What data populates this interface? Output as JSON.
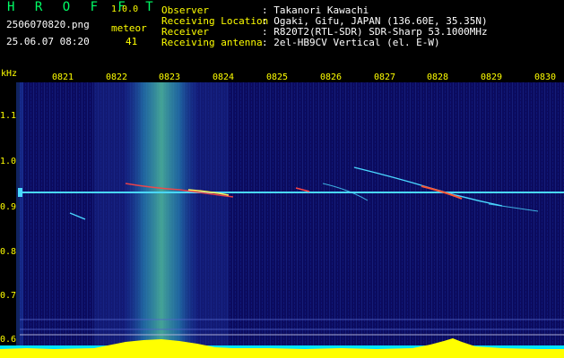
{
  "app": {
    "title": "H R O F F T",
    "version": "1.0.0"
  },
  "file": {
    "name": "2506070820.png",
    "datetime": "25.06.07 08:20"
  },
  "meteor": {
    "label": "meteor",
    "count": "41"
  },
  "info": [
    {
      "label": "Observer",
      "value": ": Takanori Kawachi"
    },
    {
      "label": "Receiving Location",
      "value": ": Ogaki, Gifu, JAPAN (136.60E, 35.35N)"
    },
    {
      "label": "Receiver",
      "value": ": R820T2(RTL-SDR) SDR-Sharp 53.1000MHz"
    },
    {
      "label": "Receiving antenna",
      "value": ": 2el-HB9CV Vertical (el. E-W)"
    }
  ],
  "axis": {
    "unit": "kHz",
    "y_ticks": [
      "1.1",
      "1.0",
      "0.9",
      "0.8",
      "0.7",
      "0.6"
    ],
    "x_ticks": [
      "0821",
      "0822",
      "0823",
      "0824",
      "0825",
      "0826",
      "0827",
      "0828",
      "0829",
      "0830"
    ]
  },
  "colors": {
    "title": "#00ff66",
    "labels": "#ffff00",
    "text": "#ffffff",
    "background": "#0a0a55",
    "carrier": "#4ad8ff",
    "level": "#ffff00",
    "baseline": "#00e5ff"
  }
}
